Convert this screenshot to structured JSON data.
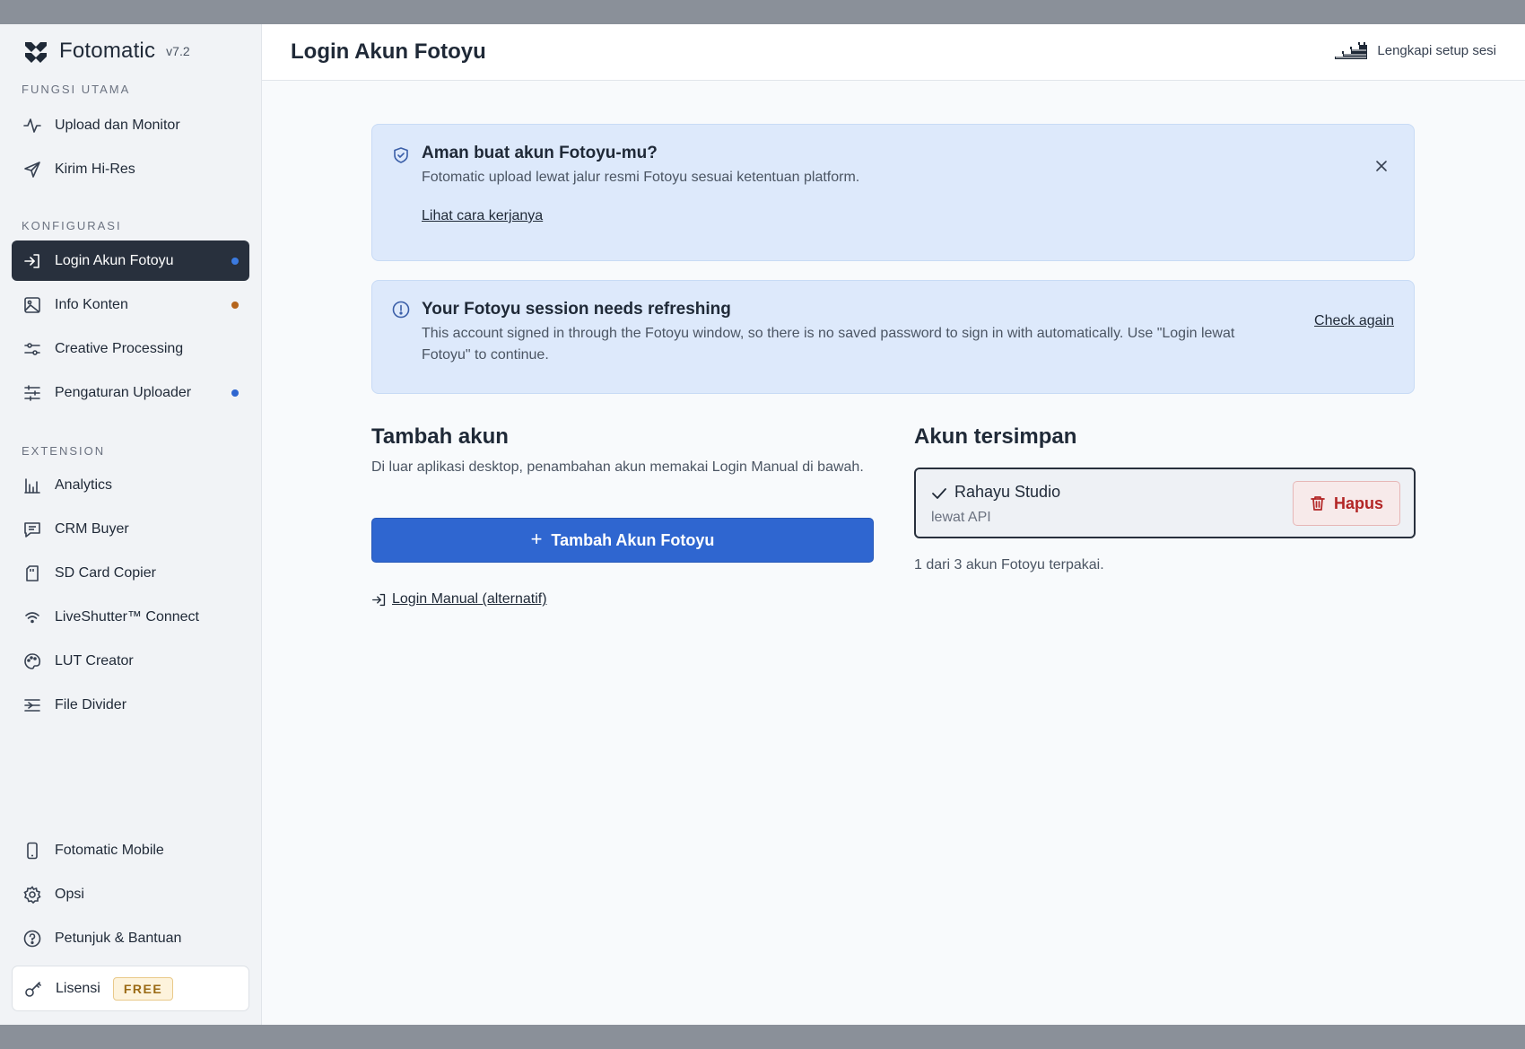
{
  "brand": {
    "name": "Fotomatic",
    "version": "v7.2"
  },
  "sidebar": {
    "sections": [
      {
        "label": "FUNGSI UTAMA"
      },
      {
        "label": "KONFIGURASI"
      },
      {
        "label": "EXTENSION"
      }
    ],
    "items": [
      {
        "label": "Upload dan Monitor",
        "icon": "activity-icon"
      },
      {
        "label": "Kirim Hi-Res",
        "icon": "send-icon"
      },
      {
        "label": "Login Akun Fotoyu",
        "icon": "login-icon",
        "active": true,
        "dot": "#2f66d0"
      },
      {
        "label": "Info Konten",
        "icon": "image-icon",
        "dot": "#b5651d"
      },
      {
        "label": "Creative Processing",
        "icon": "sliders-icon"
      },
      {
        "label": "Pengaturan Uploader",
        "icon": "settings-sliders-icon",
        "dot": "#2f66d0"
      },
      {
        "label": "Analytics",
        "icon": "bar-chart-icon"
      },
      {
        "label": "CRM Buyer",
        "icon": "message-icon"
      },
      {
        "label": "SD Card Copier",
        "icon": "sd-card-icon"
      },
      {
        "label": "LiveShutter™ Connect",
        "icon": "wifi-icon"
      },
      {
        "label": "LUT Creator",
        "icon": "palette-icon"
      },
      {
        "label": "File Divider",
        "icon": "divider-icon"
      },
      {
        "label": "Fotomatic Mobile",
        "icon": "smartphone-icon"
      },
      {
        "label": "Opsi",
        "icon": "gear-icon"
      },
      {
        "label": "Petunjuk & Bantuan",
        "icon": "help-icon"
      }
    ],
    "license": {
      "label": "Lisensi",
      "badge": "FREE"
    }
  },
  "header": {
    "title": "Login Akun Fotoyu",
    "setup_label": "Lengkapi setup sesi"
  },
  "alerts": {
    "safety": {
      "title": "Aman buat akun Fotoyu-mu?",
      "body": "Fotomatic upload lewat jalur resmi Fotoyu sesuai ketentuan platform.",
      "link": "Lihat cara kerjanya"
    },
    "session": {
      "title": "Your Fotoyu session needs refreshing",
      "body": "This account signed in through the Fotoyu window, so there is no saved password to sign in with automatically. Use \"Login lewat Fotoyu\" to continue.",
      "action": "Check again"
    }
  },
  "add_account": {
    "heading": "Tambah akun",
    "description": "Di luar aplikasi desktop, penambahan akun memakai Login Manual di bawah.",
    "button": "Tambah Akun Fotoyu",
    "manual_link": "Login Manual (alternatif)"
  },
  "saved_accounts": {
    "heading": "Akun tersimpan",
    "accounts": [
      {
        "name": "Rahayu Studio",
        "method": "lewat API",
        "delete_label": "Hapus"
      }
    ],
    "usage": "1 dari 3 akun Fotoyu terpakai."
  }
}
